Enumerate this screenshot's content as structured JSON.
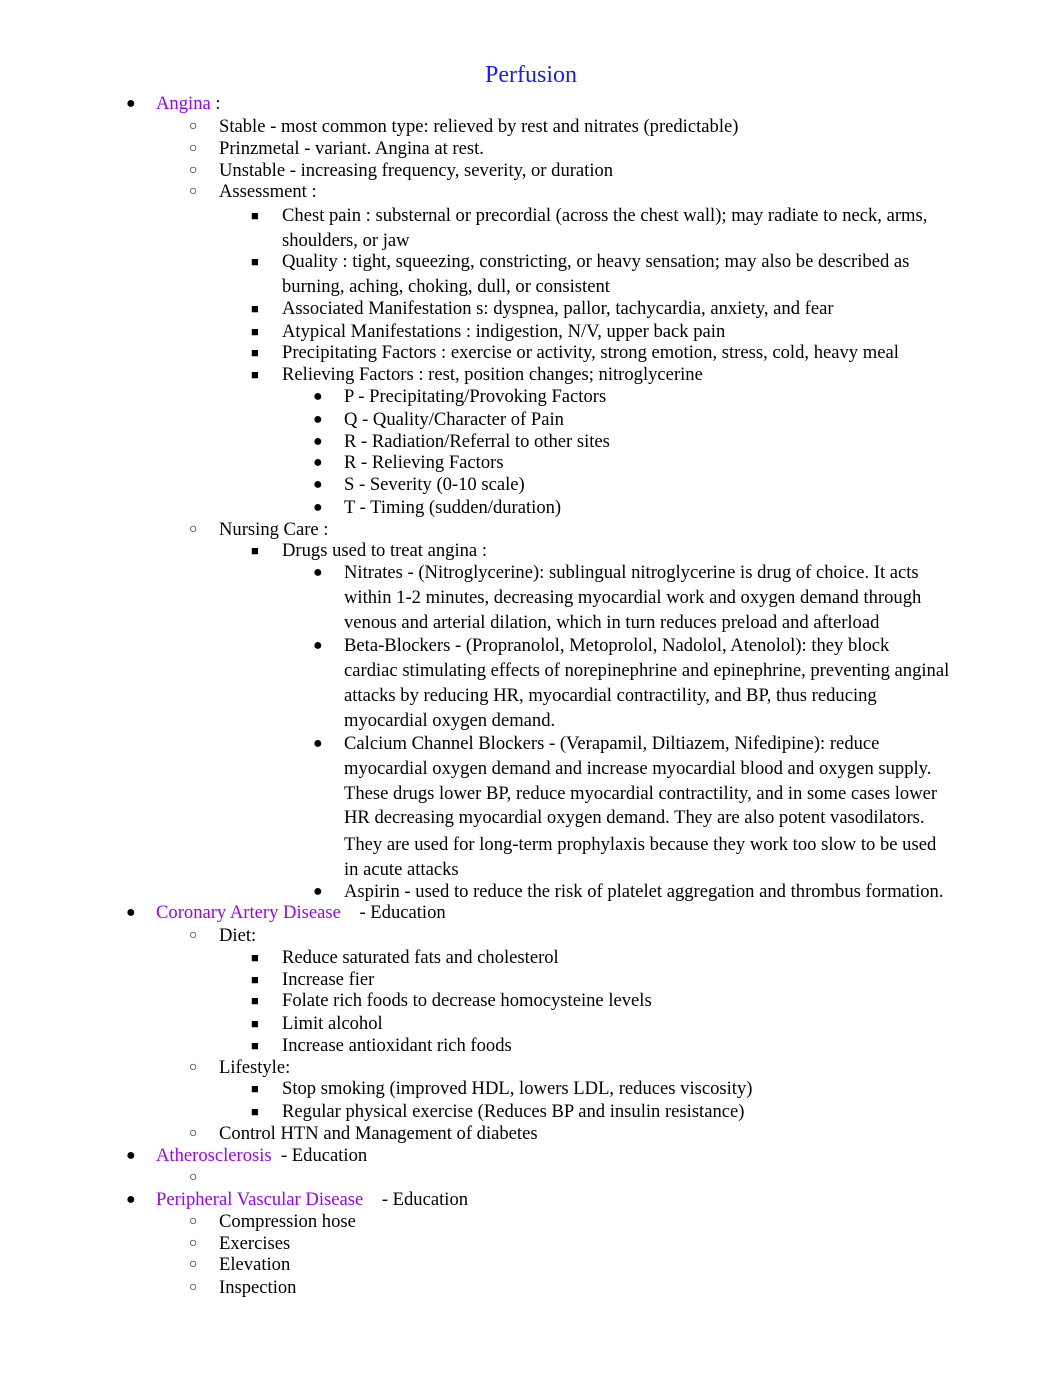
{
  "document": {
    "title": "Perfusion",
    "colors": {
      "title": "#1a1aff",
      "heading": "#9900ff",
      "text": "#000000"
    },
    "bullet_glyphs": {
      "level1": "●",
      "level2": "○",
      "level3": "■",
      "level4": "●"
    }
  },
  "angina": {
    "heading": "Angina",
    "heading_suffix": " :",
    "types": [
      "Stable - most common type: relieved by rest and nitrates (predictable)",
      "Prinzmetal - variant. Angina at rest.",
      "Unstable - increasing frequency, severity, or duration"
    ],
    "assessment": {
      "label": "Assessment :",
      "items": [
        {
          "line1": "Chest pain  : substernal or precordial (across the chest wall); may radiate to neck, arms,",
          "line2": "shoulders, or jaw"
        },
        {
          "line1": "Quality : tight, squeezing, constricting, or heavy sensation; may also be described as",
          "line2": "burning, aching, choking, dull, or consistent"
        },
        {
          "line1": "Associated Manifestation  s: dyspnea, pallor, tachycardia, anxiety, and fear"
        },
        {
          "line1": "Atypical Manifestations  : indigestion, N/V, upper back pain"
        },
        {
          "line1": "Precipitating Factors   : exercise or activity, strong emotion, stress, cold, heavy meal"
        },
        {
          "line1": "Relieving Factors : rest, position changes; nitroglycerine"
        }
      ],
      "pqrst": [
        "P - Precipitating/Provoking Factors",
        "Q - Quality/Character of Pain",
        "R - Radiation/Referral to other sites",
        "R - Relieving Factors",
        "S - Severity (0-10 scale)",
        "T - Timing (sudden/duration)"
      ]
    },
    "nursing_care": {
      "label": "Nursing Care  :",
      "drugs_label": "Drugs used to treat angina   :",
      "drugs": [
        {
          "lines": [
            "Nitrates  - (Nitroglycerine): sublingual nitroglycerine is drug of choice. It acts",
            "within 1-2 minutes, decreasing myocardial work and oxygen demand through",
            "venous and arterial dilation, which in turn reduces preload and afterload"
          ]
        },
        {
          "lines": [
            "Beta-Blockers  - (Propranolol, Metoprolol, Nadolol, Atenolol): they block",
            "cardiac stimulating effects of norepinephrine and epinephrine, preventing anginal",
            "attacks by reducing HR, myocardial contractility, and BP, thus reducing",
            "myocardial oxygen demand."
          ]
        },
        {
          "lines": [
            "Calcium Channel Blockers    - (Verapamil, Diltiazem, Nifedipine): reduce",
            "myocardial oxygen demand and increase myocardial blood and oxygen supply.",
            "These drugs lower BP, reduce myocardial contractility, and in some cases lower",
            "HR decreasing myocardial oxygen demand. They are also potent vasodilators.",
            "They are used for long-term prophylaxis because they work too slow to be used",
            "in acute attacks"
          ]
        },
        {
          "lines": [
            "Aspirin  - used to reduce the risk of platelet aggregation and thrombus formation."
          ]
        }
      ]
    }
  },
  "cad": {
    "heading": "Coronary Artery Disease",
    "heading_suffix": "    - Education",
    "diet": {
      "label": "Diet:",
      "items": [
        "Reduce saturated fats and cholesterol",
        "Increase fier",
        "Folate rich foods to decrease homocysteine levels",
        "Limit alcohol",
        "Increase antioxidant rich foods"
      ]
    },
    "lifestyle": {
      "label": "Lifestyle:",
      "items": [
        "Stop smoking (improved HDL, lowers LDL, reduces viscosity)",
        "Regular physical exercise (Reduces BP and insulin resistance)"
      ]
    },
    "control": "Control HTN and Management of diabetes"
  },
  "atherosclerosis": {
    "heading": "Atherosclerosis",
    "heading_suffix": "  - Education"
  },
  "pvd": {
    "heading": "Peripheral Vascular Disease",
    "heading_suffix": "    - Education",
    "items": [
      "Compression hose",
      "Exercises",
      "Elevation",
      "Inspection"
    ]
  }
}
